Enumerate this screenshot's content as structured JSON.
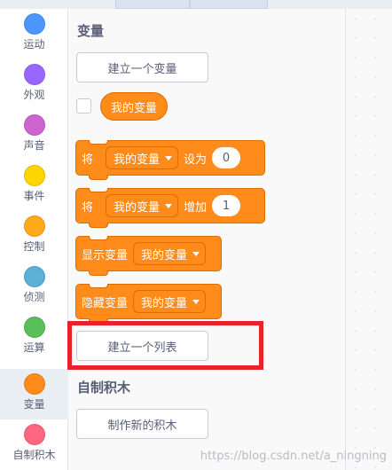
{
  "categories": [
    {
      "label": "运动",
      "color": "#4c97ff"
    },
    {
      "label": "外观",
      "color": "#9966ff"
    },
    {
      "label": "声音",
      "color": "#cf63cf"
    },
    {
      "label": "事件",
      "color": "#ffd500"
    },
    {
      "label": "控制",
      "color": "#ffab19"
    },
    {
      "label": "侦测",
      "color": "#5cb1d6"
    },
    {
      "label": "运算",
      "color": "#59c059"
    },
    {
      "label": "变量",
      "color": "#ff8c1a"
    },
    {
      "label": "自制积木",
      "color": "#ff6680"
    }
  ],
  "selected_category": "变量",
  "variables": {
    "title": "变量",
    "make_variable_button": "建立一个变量",
    "my_variable": "我的变量",
    "set_block": {
      "prefix": "将",
      "dropdown": "我的变量",
      "action": "设为",
      "value": "0"
    },
    "change_block": {
      "prefix": "将",
      "dropdown": "我的变量",
      "action": "增加",
      "value": "1"
    },
    "show_block": {
      "label": "显示变量",
      "dropdown": "我的变量"
    },
    "hide_block": {
      "label": "隐藏变量",
      "dropdown": "我的变量"
    },
    "make_list_button": "建立一个列表"
  },
  "my_blocks": {
    "title": "自制积木",
    "make_block_button": "制作新的积木"
  },
  "watermark": "https://blog.csdn.net/a_ningning",
  "colors": {
    "variables_block": "#ff8c1a",
    "highlight": "#e8212c"
  }
}
